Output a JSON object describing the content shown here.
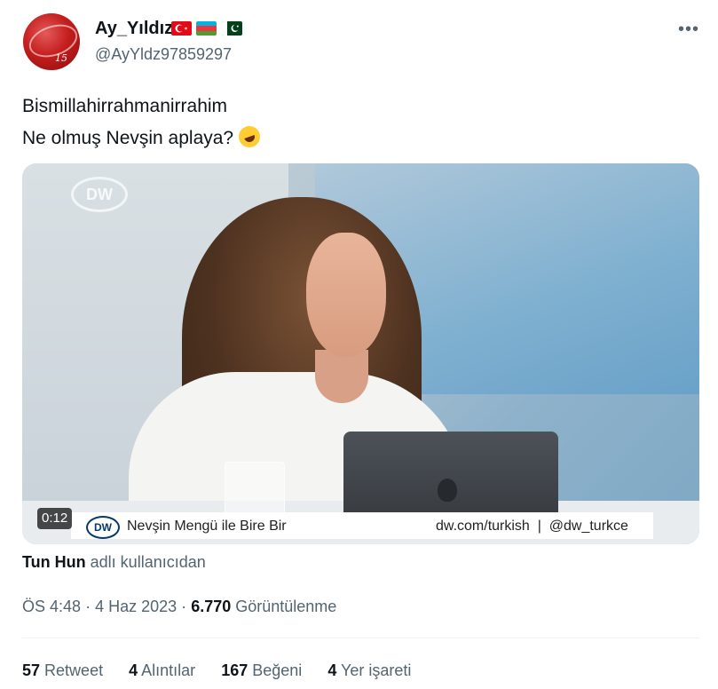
{
  "author": {
    "display_name": "Ay_Yıldız",
    "handle": "@AyYldz97859297",
    "avatar_number": "15",
    "flags": [
      "turkey-flag",
      "azerbaijan-flag",
      "pakistan-flag"
    ]
  },
  "more_label": "•••",
  "tweet": {
    "line1": "Bismillahirrahmanirrahim",
    "line2": "Ne olmuş Nevşin aplaya?",
    "emoji": "rolling-on-floor-laughing-emoji"
  },
  "video": {
    "duration": "0:12",
    "watermark": "DW",
    "lower_third_logo": "DW",
    "show_name": "Nevşin Mengü ile Bire Bir",
    "url_text": "dw.com/turkish  |  @dw_turkce"
  },
  "source": {
    "user": "Tun Hun",
    "suffix": "adlı kullanıcıdan"
  },
  "meta": {
    "time": "ÖS 4:48",
    "date": "4 Haz 2023",
    "separator": "·",
    "views_count": "6.770",
    "views_label": "Görüntülenme"
  },
  "stats": [
    {
      "count": "57",
      "label": "Retweet"
    },
    {
      "count": "4",
      "label": "Alıntılar"
    },
    {
      "count": "167",
      "label": "Beğeni"
    },
    {
      "count": "4",
      "label": "Yer işareti"
    }
  ],
  "colors": {
    "text": "#0f1419",
    "secondary": "#536471",
    "divider": "#eff3f4",
    "avatar_red": "#c41e1e"
  }
}
